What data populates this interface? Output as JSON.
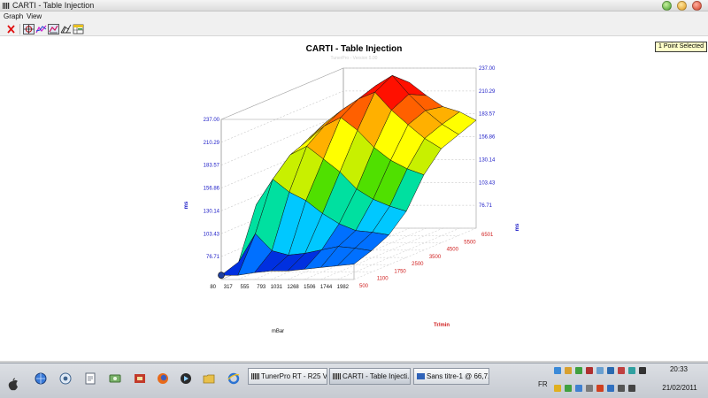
{
  "window": {
    "title": "CARTI - Table Injection"
  },
  "menu": {
    "items": [
      "Graph",
      "View"
    ]
  },
  "chart_header": {
    "title": "CARTI - Table Injection",
    "watermark": "TunerPro - Version 5.00",
    "selection_badge": "1 Point Selected"
  },
  "chart_data": {
    "type": "surface3d",
    "title": "CARTI - Table Injection",
    "zlabel": "ms",
    "xlabel": "mBar",
    "ylabel": "Tr/min",
    "z_ticks": [
      "237.00",
      "210.29",
      "183.57",
      "156.86",
      "130.14",
      "103.43",
      "76.71"
    ],
    "x_ticks": [
      "80",
      "317",
      "555",
      "793",
      "1031",
      "1268",
      "1506",
      "1744",
      "1982"
    ],
    "y_ticks": [
      "500",
      "1100",
      "1750",
      "2500",
      "3500",
      "4500",
      "5500",
      "6501"
    ],
    "zlim": [
      50,
      237
    ],
    "surface_z": [
      [
        55,
        55,
        58,
        60,
        60,
        62,
        64,
        66,
        68
      ],
      [
        62,
        95,
        75,
        70,
        72,
        76,
        80,
        78,
        75
      ],
      [
        120,
        150,
        135,
        125,
        110,
        98,
        90,
        88,
        85
      ],
      [
        140,
        170,
        180,
        165,
        150,
        130,
        118,
        110,
        104
      ],
      [
        160,
        178,
        195,
        205,
        190,
        170,
        155,
        145,
        138
      ],
      [
        172,
        190,
        205,
        218,
        226,
        205,
        188,
        172,
        160
      ],
      [
        178,
        195,
        210,
        225,
        237,
        215,
        196,
        180,
        168
      ],
      [
        182,
        196,
        206,
        212,
        220,
        205,
        192,
        186,
        176
      ]
    ],
    "colors": [
      "#0030e0",
      "#0070ff",
      "#00c8ff",
      "#00e0a0",
      "#50e000",
      "#c8f000",
      "#ffff00",
      "#ffb000",
      "#ff6000",
      "#ff1000"
    ],
    "grid": true
  },
  "taskbar": {
    "buttons": [
      "TunerPro RT - R25 V...",
      "CARTI - Table Injecti...",
      "Sans titre-1 @ 66,7..."
    ],
    "language": "FR",
    "time": "20:33",
    "date": "21/02/2011"
  }
}
